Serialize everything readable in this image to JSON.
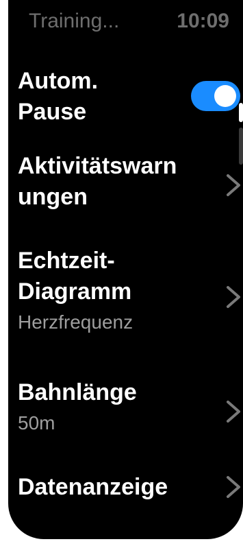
{
  "status_bar": {
    "title": "Training...",
    "time": "10:09"
  },
  "settings": {
    "auto_pause": {
      "title": "Autom.\nPause",
      "toggle_on": true
    },
    "activity_alerts": {
      "title": "Aktivitätswarn\nungen"
    },
    "realtime_chart": {
      "title": "Echtzeit-\nDiagramm",
      "value": "Herzfrequenz"
    },
    "lane_length": {
      "title": "Bahnlänge",
      "value": "50m"
    },
    "data_display": {
      "title": "Datenanzeige"
    }
  },
  "colors": {
    "accent": "#1a8cff",
    "background": "#000000",
    "text_primary": "#ffffff",
    "text_secondary": "#9e9e9e",
    "status_text": "#6e6e6e"
  }
}
